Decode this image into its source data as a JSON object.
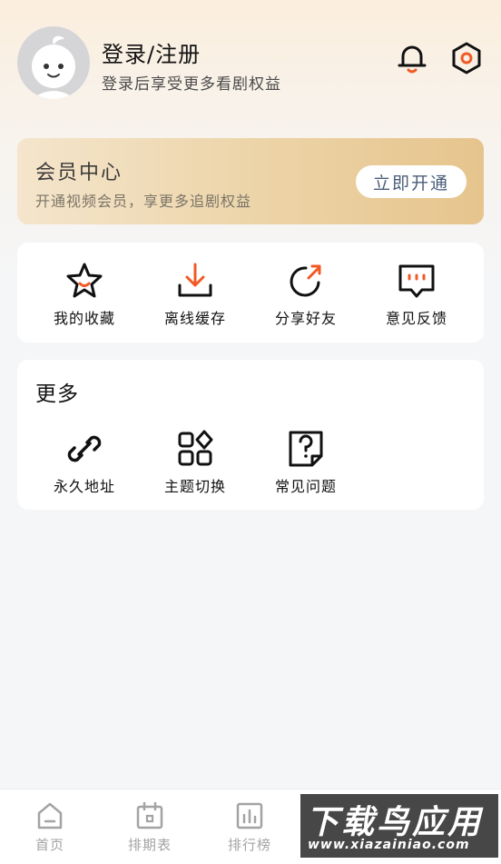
{
  "header": {
    "title": "登录/注册",
    "subtitle": "登录后享受更多看剧权益",
    "icons": [
      "avatar",
      "bell-icon",
      "settings-icon"
    ]
  },
  "vip": {
    "title": "会员中心",
    "subtitle": "开通视频会员，享更多追剧权益",
    "button_label": "立即开通"
  },
  "quick_actions": [
    {
      "label": "我的收藏",
      "icon": "star-icon"
    },
    {
      "label": "离线缓存",
      "icon": "download-icon"
    },
    {
      "label": "分享好友",
      "icon": "share-icon"
    },
    {
      "label": "意见反馈",
      "icon": "feedback-icon"
    }
  ],
  "more": {
    "title": "更多",
    "items": [
      {
        "label": "永久地址",
        "icon": "link-icon"
      },
      {
        "label": "主题切换",
        "icon": "theme-icon"
      },
      {
        "label": "常见问题",
        "icon": "faq-icon"
      }
    ]
  },
  "tabbar": {
    "tabs": [
      {
        "label": "首页",
        "icon": "home-icon"
      },
      {
        "label": "排期表",
        "icon": "calendar-icon"
      },
      {
        "label": "排行榜",
        "icon": "ranking-icon"
      }
    ]
  },
  "watermark": {
    "text": "下载鸟应用",
    "url": "www.xiazainiao.com"
  },
  "colors": {
    "accent": "#f15a24",
    "vip_gold": "#e6c48d",
    "vip_button_text": "#4a5d78",
    "tab_inactive": "#a3a3a3"
  }
}
